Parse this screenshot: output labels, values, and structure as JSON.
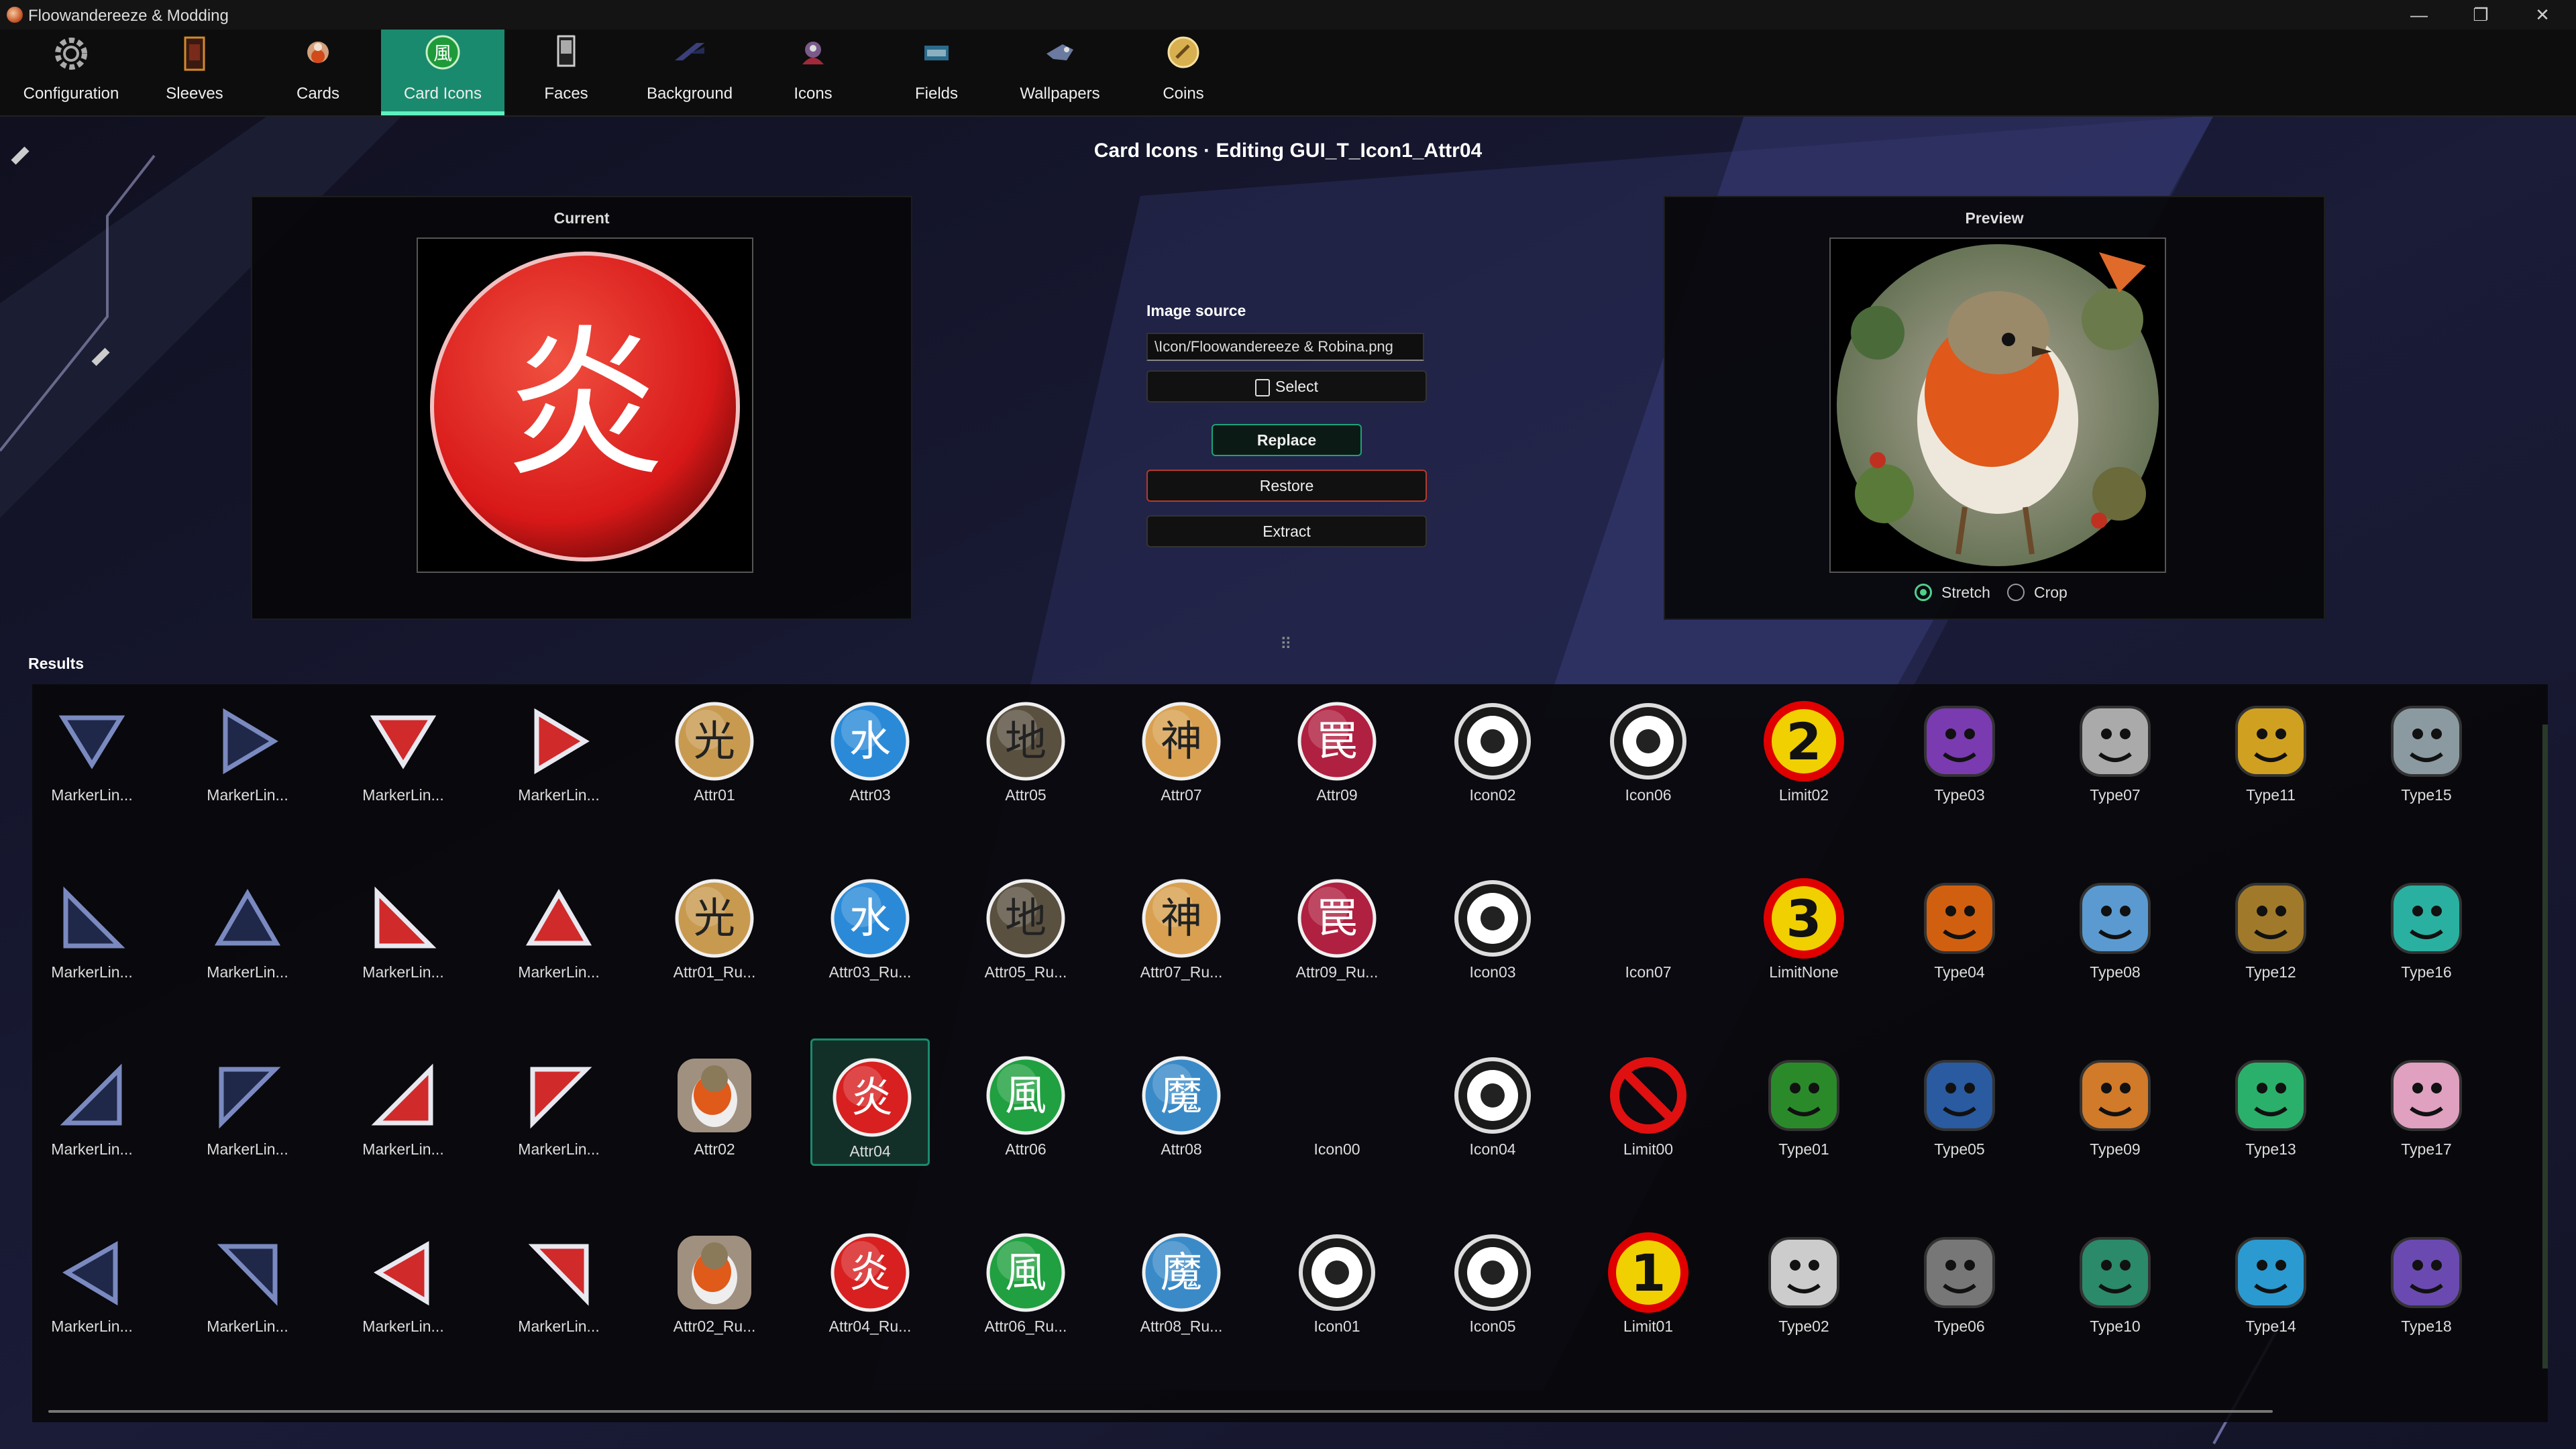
{
  "window": {
    "title": "Floowandereeze & Modding",
    "min_glyph": "—",
    "max_glyph": "❐",
    "close_glyph": "✕"
  },
  "toolbar": {
    "items": [
      {
        "label": "Configuration",
        "icon": "gear-icon"
      },
      {
        "label": "Sleeves",
        "icon": "sleeve-icon"
      },
      {
        "label": "Cards",
        "icon": "card-icon"
      },
      {
        "label": "Card Icons",
        "icon": "wind-attribute-icon"
      },
      {
        "label": "Faces",
        "icon": "face-icon"
      },
      {
        "label": "Background",
        "icon": "background-icon"
      },
      {
        "label": "Icons",
        "icon": "profile-icon"
      },
      {
        "label": "Fields",
        "icon": "field-icon"
      },
      {
        "label": "Wallpapers",
        "icon": "wallpaper-icon"
      },
      {
        "label": "Coins",
        "icon": "coin-icon"
      }
    ],
    "active_label": "Card Icons"
  },
  "heading": "Card Icons · Editing GUI_T_Icon1_Attr04",
  "current": {
    "title": "Current",
    "glyph": "炎"
  },
  "preview": {
    "title": "Preview"
  },
  "source": {
    "label": "Image source",
    "value": "\\Icon/Floowandereeze & Robina.png",
    "select_label": "Select",
    "replace_label": "Replace",
    "restore_label": "Restore",
    "extract_label": "Extract"
  },
  "fit": {
    "stretch": "Stretch",
    "crop": "Crop",
    "selected": "Stretch"
  },
  "results": {
    "label": "Results",
    "selected": "Attr04",
    "columns": [
      [
        "MarkerLin...",
        "MarkerLin...",
        "MarkerLin...",
        "MarkerLin..."
      ],
      [
        "MarkerLin...",
        "MarkerLin...",
        "MarkerLin...",
        "MarkerLin..."
      ],
      [
        "MarkerLin...",
        "MarkerLin...",
        "MarkerLin...",
        "MarkerLin..."
      ],
      [
        "MarkerLin...",
        "MarkerLin...",
        "MarkerLin...",
        "MarkerLin..."
      ],
      [
        "Attr01",
        "Attr01_Ru...",
        "Attr02",
        "Attr02_Ru..."
      ],
      [
        "Attr03",
        "Attr03_Ru...",
        "Attr04",
        "Attr04_Ru..."
      ],
      [
        "Attr05",
        "Attr05_Ru...",
        "Attr06",
        "Attr06_Ru..."
      ],
      [
        "Attr07",
        "Attr07_Ru...",
        "Attr08",
        "Attr08_Ru..."
      ],
      [
        "Attr09",
        "Attr09_Ru...",
        "Icon00",
        "Icon01"
      ],
      [
        "Icon02",
        "Icon03",
        "Icon04",
        "Icon05"
      ],
      [
        "Icon06",
        "Icon07",
        "Limit00",
        "Limit01"
      ],
      [
        "Limit02",
        "LimitNone",
        "Type01",
        "Type02"
      ],
      [
        "Type03",
        "Type04",
        "Type05",
        "Type06"
      ],
      [
        "Type07",
        "Type08",
        "Type09",
        "Type10"
      ],
      [
        "Type11",
        "Type12",
        "Type13",
        "Type14"
      ],
      [
        "Type15",
        "Type16",
        "Type17",
        "Type18"
      ]
    ],
    "glyphs": {
      "Attr01": "光",
      "Attr01_Ru...": "光",
      "Attr03": "水",
      "Attr03_Ru...": "水",
      "Attr04": "炎",
      "Attr04_Ru...": "炎",
      "Attr05": "地",
      "Attr05_Ru...": "地",
      "Attr06": "風",
      "Attr06_Ru...": "風",
      "Attr07": "神",
      "Attr07_Ru...": "神",
      "Attr08": "魔",
      "Attr08_Ru...": "魔",
      "Attr09": "罠",
      "Attr09_Ru...": "罠",
      "Limit01": "1",
      "Limit02": "2",
      "LimitNone": "3"
    }
  }
}
